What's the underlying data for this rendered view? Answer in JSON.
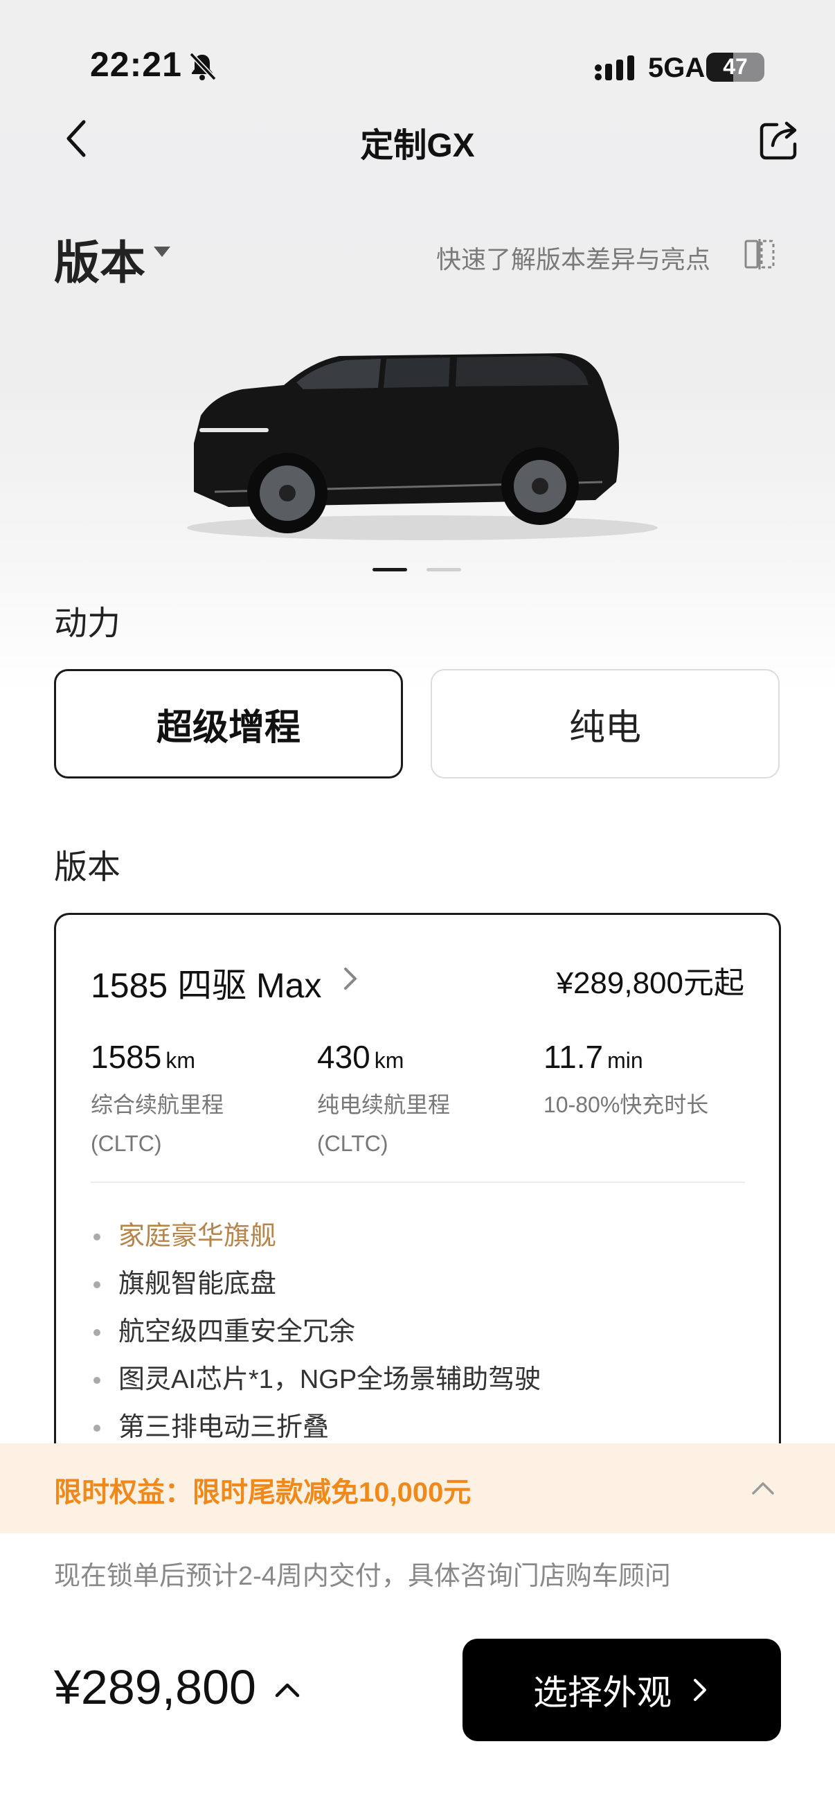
{
  "status_bar": {
    "time": "22:21",
    "network": "5GA",
    "battery_level": 47,
    "battery_text": "47",
    "icons": [
      "bell-muted-icon",
      "signal-icon"
    ]
  },
  "nav": {
    "title": "定制GX",
    "back_icon": "chevron-left-icon",
    "share_icon": "share-icon"
  },
  "header": {
    "version_heading": "版本",
    "compare_text": "快速了解版本差异与亮点",
    "compare_icon": "compare-icon"
  },
  "carousel": {
    "active_index": 0,
    "count": 2
  },
  "power": {
    "title": "动力",
    "options": [
      {
        "label": "超级增程",
        "selected": true
      },
      {
        "label": "纯电",
        "selected": false
      }
    ]
  },
  "version": {
    "title": "版本",
    "card": {
      "name": "1585 四驱 Max",
      "price": "¥289,800元起",
      "specs": [
        {
          "value": "1585",
          "unit": "km",
          "label": "综合续航里程 (CLTC)"
        },
        {
          "value": "430",
          "unit": "km",
          "label": "纯电续航里程 (CLTC)"
        },
        {
          "value": "11.7",
          "unit": "min",
          "label": "10-80%快充时长"
        }
      ],
      "features": [
        "家庭豪华旗舰",
        "旗舰智能底盘",
        "航空级四重安全冗余",
        "图灵AI芯片*1，NGP全场景辅助驾驶",
        "第三排电动三折叠"
      ]
    }
  },
  "promo": {
    "text": "限时权益：限时尾款减免10,000元"
  },
  "delivery_note": "现在锁单后预计2-4周内交付，具体咨询门店购车顾问",
  "footer": {
    "total_price": "¥289,800",
    "cta_label": "选择外观"
  },
  "colors": {
    "accent_orange": "#f0891a",
    "promo_bg": "#fdf1e4",
    "highlight_gold": "#b5854a",
    "cta_bg": "#000000"
  }
}
